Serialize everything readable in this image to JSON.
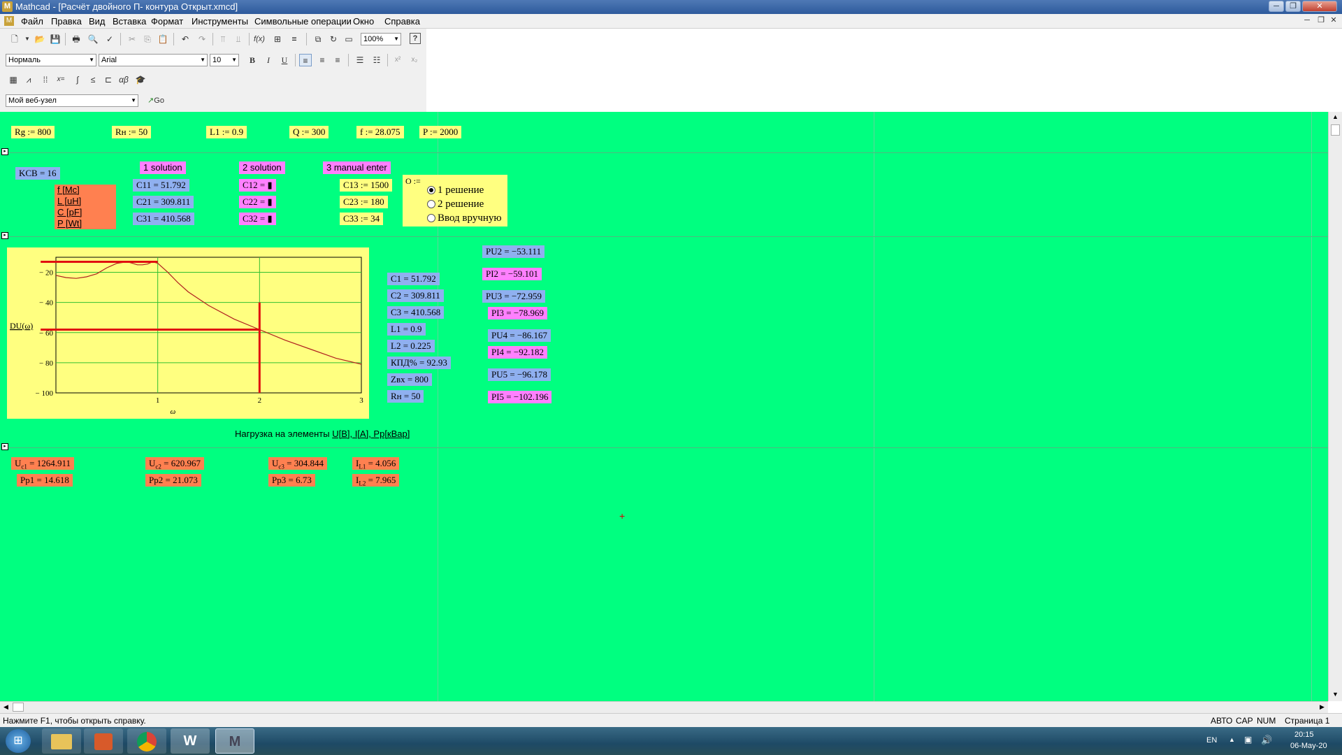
{
  "window": {
    "title": "Mathcad - [Расчёт двойного П- контура Открыт.xmcd]"
  },
  "menu": [
    "Файл",
    "Правка",
    "Вид",
    "Вставка",
    "Формат",
    "Инструменты",
    "Символьные операции",
    "Окно",
    "Справка"
  ],
  "toolbar": {
    "zoom": "100%",
    "style": "Нормаль",
    "font": "Arial",
    "size": "10",
    "bold": "B",
    "italic": "I",
    "underline": "U",
    "web_node": "Мой веб-узел",
    "go": "Go"
  },
  "inputs": {
    "rg": "Rg := 800",
    "rn": "Rн := 50",
    "l1": "L1 := 0.9",
    "q": "Q := 300",
    "f": "f := 28.075",
    "p": "P := 2000"
  },
  "solutions": {
    "ksv": "KCB = 16",
    "units": [
      "f [Mc]",
      "L [uH]",
      "C [pF]",
      "P [Wt]"
    ],
    "headers": [
      "1 solution",
      "2 solution",
      "3 manual enter"
    ],
    "col1": [
      "C11 = 51.792",
      "C21 = 309.811",
      "C31 = 410.568"
    ],
    "col2": [
      "C12 = ▮",
      "C22 = ▮",
      "C32 = ▮"
    ],
    "col3": [
      "C13 := 1500",
      "C23 := 180",
      "C33 := 34"
    ]
  },
  "radio": {
    "label": "O :=",
    "options": [
      "1 решение",
      "2 решение",
      "Ввод вручную"
    ]
  },
  "results": [
    "C1 = 51.792",
    "C2 = 309.811",
    "C3 = 410.568",
    "L1 = 0.9",
    "L2 = 0.225",
    "КПД% = 92.93",
    "Zвх = 800",
    "Rн = 50"
  ],
  "phases": [
    {
      "t": "PU2 = −53.111",
      "c": "b"
    },
    {
      "t": "PI2 = −59.101",
      "c": "p"
    },
    {
      "t": "PU3 = −72.959",
      "c": "b"
    },
    {
      "t": "PI3 = −78.969",
      "c": "p"
    },
    {
      "t": "PU4 = −86.167",
      "c": "b"
    },
    {
      "t": "PI4 = −92.182",
      "c": "p"
    },
    {
      "t": "PU5 = −96.178",
      "c": "b"
    },
    {
      "t": "PI5 = −102.196",
      "c": "p"
    }
  ],
  "load": {
    "caption": "Нагрузка на элементы",
    "caption_link": "U[B], I[A], Pр[кВар]",
    "u": [
      {
        "name": "U",
        "sub": "c1",
        "val": " = 1264.911"
      },
      {
        "name": "U",
        "sub": "c2",
        "val": " = 620.967"
      },
      {
        "name": "U",
        "sub": "c3",
        "val": " = 304.844"
      },
      {
        "name": "I",
        "sub": "L1",
        "val": " = 4.056"
      }
    ],
    "p": [
      {
        "name": "Pp1",
        "sub": "",
        "val": " = 14.618"
      },
      {
        "name": "Pp2",
        "sub": "",
        "val": " = 21.073"
      },
      {
        "name": "Pp3",
        "sub": "",
        "val": " = 6.73"
      },
      {
        "name": "I",
        "sub": "L2",
        "val": " = 7.965"
      }
    ]
  },
  "chart_data": {
    "type": "line",
    "ylabel": "DU(ω)",
    "xlabel": "ω",
    "xlim": [
      0,
      3
    ],
    "ylim": [
      -100,
      -10
    ],
    "xticks": [
      1,
      2,
      3
    ],
    "yticks": [
      -20,
      -40,
      -60,
      -80,
      -100
    ],
    "grid": true,
    "curve": [
      [
        0.0,
        -22
      ],
      [
        0.1,
        -23.5
      ],
      [
        0.2,
        -24
      ],
      [
        0.3,
        -23
      ],
      [
        0.4,
        -21
      ],
      [
        0.5,
        -17
      ],
      [
        0.6,
        -14
      ],
      [
        0.7,
        -13
      ],
      [
        0.75,
        -14
      ],
      [
        0.8,
        -15
      ],
      [
        0.85,
        -15
      ],
      [
        0.9,
        -14.5
      ],
      [
        0.95,
        -13
      ],
      [
        1.0,
        -14
      ],
      [
        1.1,
        -20
      ],
      [
        1.2,
        -27
      ],
      [
        1.3,
        -33
      ],
      [
        1.5,
        -42
      ],
      [
        1.75,
        -51
      ],
      [
        2.0,
        -58
      ],
      [
        2.25,
        -65
      ],
      [
        2.5,
        -71
      ],
      [
        2.75,
        -77
      ],
      [
        3.0,
        -81
      ]
    ],
    "markers": {
      "h_top": -13,
      "h_mid": -58,
      "v_x": 2.0,
      "v_top": -40
    }
  },
  "status": {
    "help": "Нажмите F1, чтобы открыть справку.",
    "indicators": [
      "АВТО",
      "CAP",
      "NUM",
      "Страница 1"
    ]
  },
  "taskbar": {
    "lang": "EN",
    "time": "20:15",
    "date": "06-May-20",
    "word_icon": "W",
    "mathcad_icon": "M"
  }
}
